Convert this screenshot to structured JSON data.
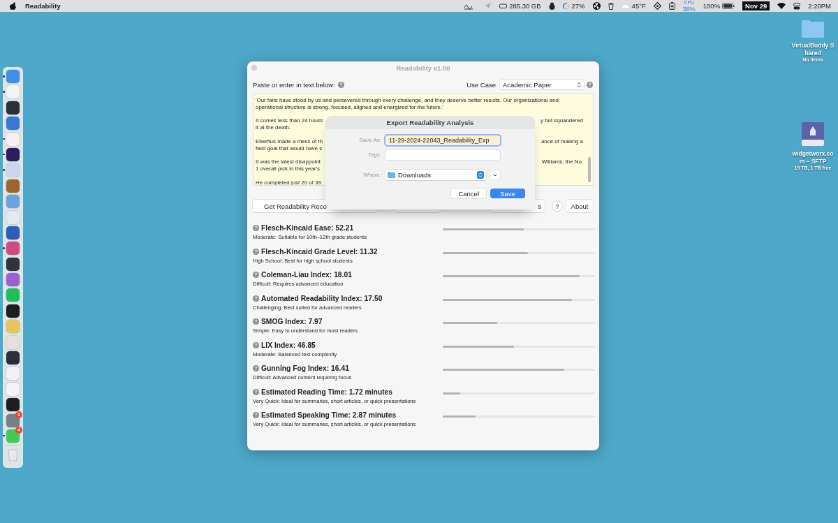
{
  "menu_bar": {
    "app_name": "Readability",
    "status": [
      {
        "kind": "icon"
      },
      {
        "kind": "disk",
        "text": "285.30 GB"
      },
      {
        "kind": "progress",
        "text": "27%"
      },
      {
        "kind": "weather",
        "text": "45°F"
      },
      {
        "kind": "cpu",
        "label": "CPU",
        "text": "38%"
      },
      {
        "kind": "battery",
        "text": "100%"
      },
      {
        "kind": "date",
        "text": "Nov 29"
      },
      {
        "kind": "clock",
        "text": "2:20PM"
      }
    ]
  },
  "dock": {
    "items": [
      {
        "color": "#3d8fe8",
        "running": true
      },
      {
        "color": "#f4f4f4",
        "running": true
      },
      {
        "color": "#2b2f36",
        "running": false
      },
      {
        "color": "#3a78d8",
        "running": false
      },
      {
        "color": "#f6f0ee",
        "running": true
      },
      {
        "color": "#2a1d5c",
        "running": true
      },
      {
        "color": "#c9d6ec",
        "running": true
      },
      {
        "color": "#a0642a",
        "running": false
      },
      {
        "color": "#6aa2e0",
        "running": false
      },
      {
        "color": "#e6e8f0",
        "running": false
      },
      {
        "color": "#2b5fb8",
        "running": false
      },
      {
        "color": "#d04a7c",
        "running": true
      },
      {
        "color": "#30333a",
        "running": false
      },
      {
        "color": "#9c5fd0",
        "running": false
      },
      {
        "color": "#1fbf55",
        "running": false
      },
      {
        "color": "#1e1e1e",
        "running": false
      },
      {
        "color": "#e8c45a",
        "running": false
      },
      {
        "color": "#e8e0d8",
        "running": false
      },
      {
        "color": "#2a2e3a",
        "running": false
      },
      {
        "color": "#f2f2f2",
        "running": false
      },
      {
        "color": "#f3f3f3",
        "running": false
      },
      {
        "color": "#1e1f22",
        "running": false
      },
      {
        "color": "#7d7f86",
        "running": false,
        "badge": "1"
      },
      {
        "color": "#3fcb55",
        "running": true,
        "badge": "4"
      }
    ]
  },
  "desktop_icons": [
    {
      "kind": "folder",
      "name": "VirtualBuddy Shared",
      "detail": "No items"
    },
    {
      "kind": "drive",
      "name": "widgetworx.com – SFTP",
      "detail": "19 TB, 1 TB free"
    }
  ],
  "window": {
    "title": "Readability v1.00",
    "prompt": "Paste or enter in text below:",
    "use_case": {
      "label": "Use Case",
      "value": "Academic Paper"
    },
    "paragraphs": [
      [
        {
          "left": "'Our fans have stood by us and persevered through every challenge, and they deserve better results. Our organizational and"
        },
        {
          "left": "operational structure is strong, focused, aligned and energized for the future.'"
        }
      ],
      [
        {
          "left": "It comes less than 24 hours",
          "right": "y but squandered"
        },
        {
          "left": "it at the death."
        }
      ],
      [
        {
          "left": "Eberflus made a mess of th",
          "right": "ance of making a"
        },
        {
          "left": "field goal that would have s"
        }
      ],
      [
        {
          "left": "It was the latest disappoint",
          "right": "Williams, the No."
        },
        {
          "left": "1 overall pick in this year's"
        }
      ],
      [
        {
          "left": "He completed just 20 of 39"
        }
      ]
    ],
    "buttons": [
      {
        "kind": "wide",
        "label": "Get Readability Reco"
      },
      {
        "kind": "hidden"
      },
      {
        "kind": "hidden2",
        "label": "s"
      },
      {
        "kind": "help",
        "label": "?"
      },
      {
        "kind": "plain",
        "label": "About"
      }
    ],
    "metrics": [
      {
        "title": "Flesch-Kincaid Ease: 52.21",
        "description": "Moderate: Suitable for 10th–12th grade students",
        "level": 0.53
      },
      {
        "title": "Flesch-Kincaid Grade Level: 11.32",
        "description": "High School: Best for high school students",
        "level": 0.56
      },
      {
        "title": "Coleman-Liau Index: 18.01",
        "description": "Difficult: Requires advanced education",
        "level": 0.9
      },
      {
        "title": "Automated Readability Index: 17.50",
        "description": "Challenging: Best suited for advanced readers",
        "level": 0.85
      },
      {
        "title": "SMOG Index: 7.97",
        "description": "Simple: Easy to understand for most readers",
        "level": 0.36
      },
      {
        "title": "LIX Index: 46.85",
        "description": "Moderate: Balanced text complexity",
        "level": 0.47
      },
      {
        "title": "Gunning Fog Index: 16.41",
        "description": "Difficult: Advanced content requiring focus",
        "level": 0.8
      },
      {
        "title": "Estimated Reading Time: 1.72 minutes",
        "description": "Very Quick: Ideal for summaries, short articles, or quick presentations",
        "level": 0.115
      },
      {
        "title": "Estimated Speaking Time: 2.87 minutes",
        "description": "Very Quick: Ideal for summaries, short articles, or quick presentations",
        "level": 0.215
      }
    ]
  },
  "dialog": {
    "title": "Export Readability Analysis",
    "save_as": {
      "label": "Save As:",
      "value": "11-29-2024-22043_Readability_Exp"
    },
    "tags": {
      "label": "Tags:"
    },
    "where": {
      "label": "Where:",
      "value": "Downloads"
    },
    "buttons": [
      {
        "kind": "cancel",
        "label": "Cancel"
      },
      {
        "kind": "default",
        "label": "Save"
      }
    ]
  }
}
